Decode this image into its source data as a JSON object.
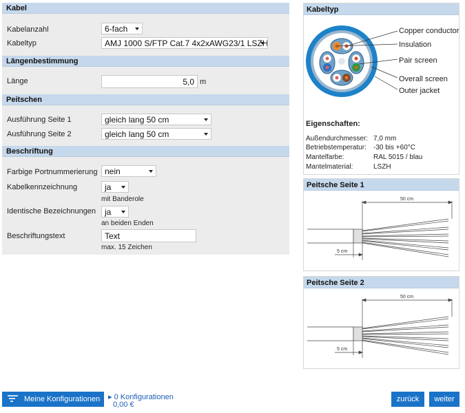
{
  "sections": {
    "kabel": {
      "title": "Kabel",
      "kabelanzahl_label": "Kabelanzahl",
      "kabelanzahl_value": "6-fach",
      "kabeltyp_label": "Kabeltyp",
      "kabeltyp_value": "AMJ 1000 S/FTP Cat.7 4x2xAWG23/1 LSZH"
    },
    "laengen": {
      "title": "Längenbestimmung",
      "laenge_label": "Länge",
      "laenge_value": "5,0",
      "laenge_unit": "m"
    },
    "peitschen": {
      "title": "Peitschen",
      "seite1_label": "Ausführung Seite 1",
      "seite1_value": "gleich lang 50 cm",
      "seite2_label": "Ausführung Seite 2",
      "seite2_value": "gleich lang 50 cm"
    },
    "beschriftung": {
      "title": "Beschriftung",
      "port_label": "Farbige Portnummerierung",
      "port_value": "nein",
      "kennz_label": "Kabelkennzeichnung",
      "kennz_value": "ja",
      "kennz_hint": "mit Banderole",
      "ident_label": "Identische Bezeichnungen",
      "ident_value": "ja",
      "ident_hint": "an beiden Enden",
      "text_label": "Beschriftungstext",
      "text_value": "Text",
      "text_hint": "max. 15 Zeichen"
    }
  },
  "kabeltyp_panel": {
    "title": "Kabeltyp",
    "legend": [
      "Copper conductor",
      "Insulation",
      "Pair screen",
      "Overall screen",
      "Outer jacket"
    ],
    "properties_title": "Eigenschaften:",
    "properties": [
      {
        "key": "Außendurchmesser:",
        "value": "7,0 mm"
      },
      {
        "key": "Betriebstemperatur:",
        "value": "-30 bis +60°C"
      },
      {
        "key": "Mantelfarbe:",
        "value": "RAL 5015 / blau"
      },
      {
        "key": "Mantelmaterial:",
        "value": "LSZH"
      }
    ],
    "colors": {
      "jacket": "#1d82c8",
      "overall_screen": "#9bb7cf"
    }
  },
  "peitsche1": {
    "title": "Peitsche Seite 1",
    "dim_long": "50 cm",
    "dim_short": "5 cm"
  },
  "peitsche2": {
    "title": "Peitsche Seite 2",
    "dim_long": "50 cm",
    "dim_short": "5 cm"
  },
  "footer": {
    "configs_button": "Meine Konfigurationen",
    "configs_count": "0 Konfigurationen",
    "configs_price": "0,00 €",
    "back_button": "zurück",
    "next_button": "weiter",
    "accent": "#1a73c8"
  }
}
